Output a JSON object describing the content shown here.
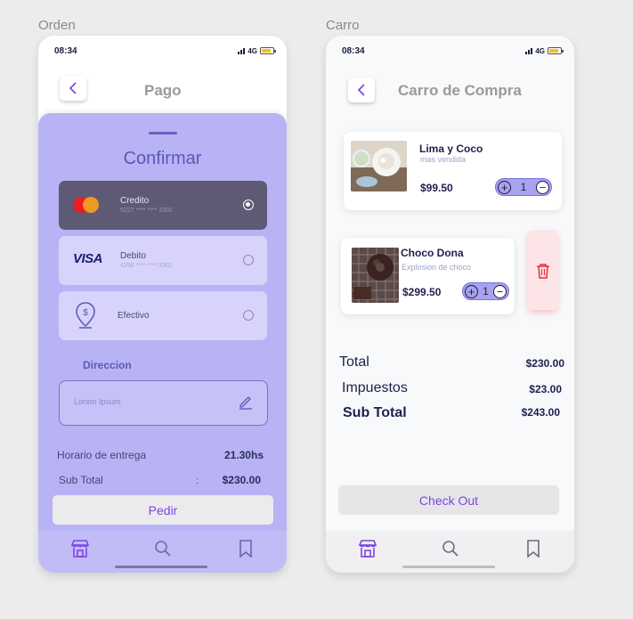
{
  "frames": {
    "orden_label": "Orden",
    "carro_label": "Carro"
  },
  "status": {
    "time": "08:34",
    "network": "4G"
  },
  "orden": {
    "title": "Pago",
    "sheet_title": "Confirmar",
    "payment_methods": [
      {
        "name": "Credito",
        "number": "5227 **** **** 3302",
        "selected": true,
        "icon": "mastercard-icon"
      },
      {
        "name": "Debito",
        "number": "4298 **** **** 3302",
        "selected": false,
        "icon": "visa-icon",
        "logo_text": "VISA"
      },
      {
        "name": "Efectivo",
        "number": "",
        "selected": false,
        "icon": "cash-pin-icon"
      }
    ],
    "direccion_label": "Direccion",
    "direccion_placeholder": "Lorem Ipsum",
    "horario_label": "Horario de entrega",
    "horario_value": "21.30hs",
    "subtotal_label": "Sub Total",
    "subtotal_colon": ":",
    "subtotal_value": "$230.00",
    "pedir_label": "Pedir"
  },
  "carro": {
    "title": "Carro de Compra",
    "items": [
      {
        "name": "Lima y Coco",
        "subtitle": "mas vendida",
        "price": "$99.50",
        "qty": "1"
      },
      {
        "name": "Choco Dona",
        "subtitle": "Explosion de choco",
        "price": "$299.50",
        "qty": "1"
      }
    ],
    "total_label": "Total",
    "total_value": "$230.00",
    "impuestos_label": "Impuestos",
    "impuestos_value": "$23.00",
    "subtotal_label": "Sub Total",
    "subtotal_value": "$243.00",
    "checkout_label": "Check Out"
  },
  "tabbar": [
    "store-icon",
    "search-icon",
    "bookmark-icon"
  ],
  "colors": {
    "accent": "#7d43e3",
    "sheet": "#b8b3f4",
    "delete": "#e2303b"
  }
}
